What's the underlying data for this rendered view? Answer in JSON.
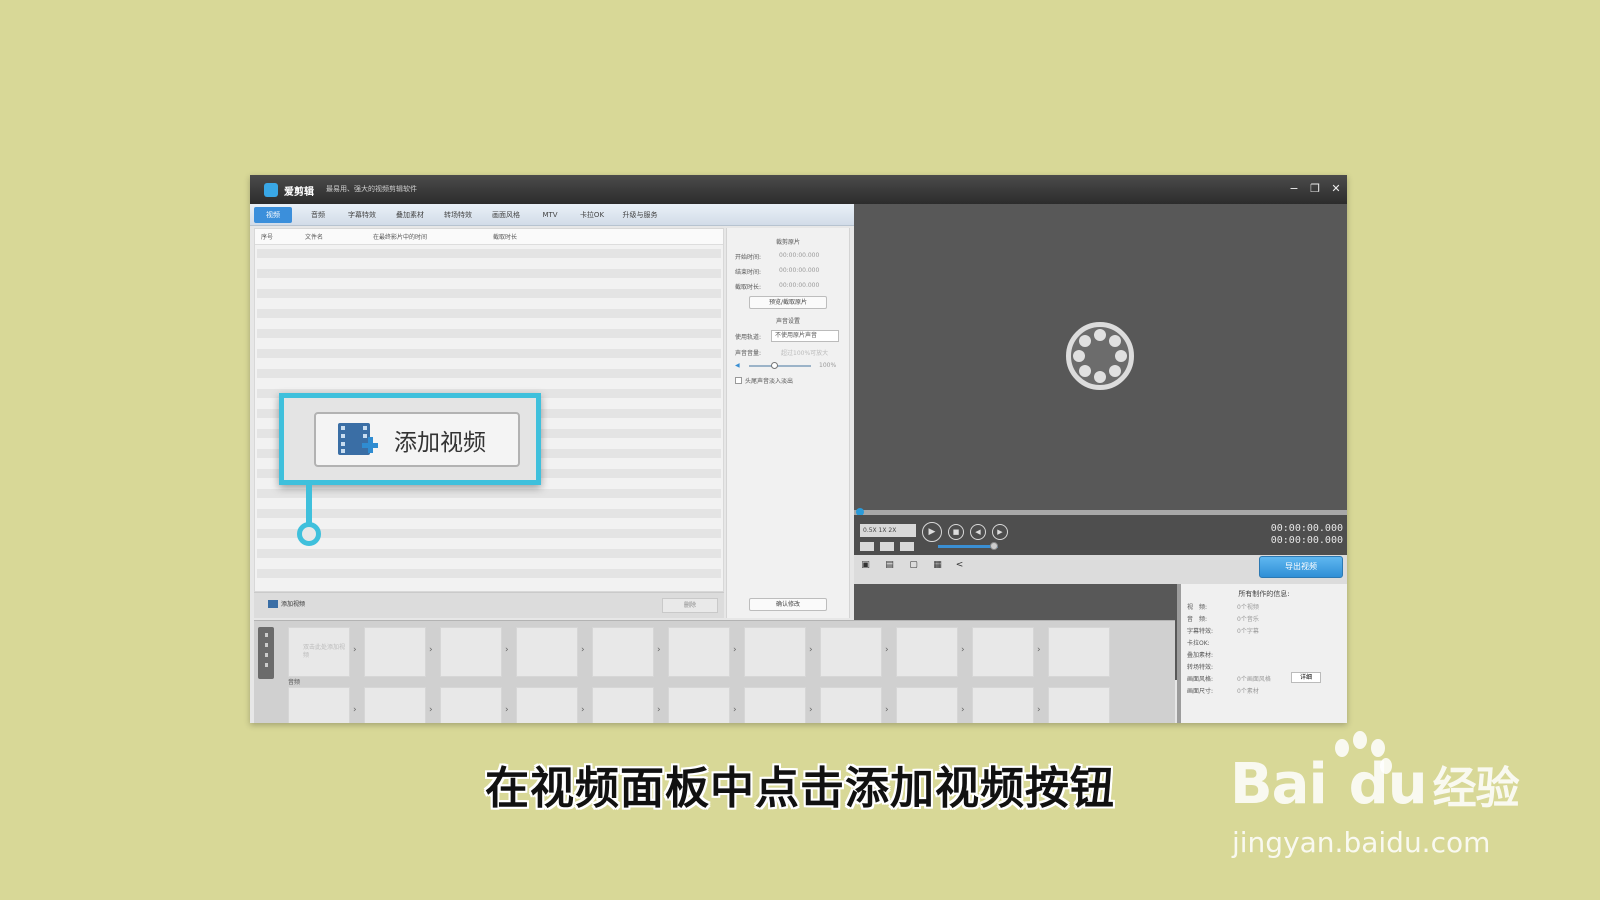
{
  "app": {
    "title": "爱剪辑",
    "subtitle": "最易用、强大的视频剪辑软件",
    "window_buttons": [
      "−",
      "❐",
      "✕"
    ]
  },
  "tabs": [
    {
      "label": "视频",
      "active": true
    },
    {
      "label": "音频",
      "active": false
    },
    {
      "label": "字幕特效",
      "active": false
    },
    {
      "label": "叠加素材",
      "active": false
    },
    {
      "label": "转场特效",
      "active": false
    },
    {
      "label": "画面风格",
      "active": false
    },
    {
      "label": "MTV",
      "active": false
    },
    {
      "label": "卡拉OK",
      "active": false
    },
    {
      "label": "升级与服务",
      "active": false
    }
  ],
  "list": {
    "columns": [
      "序号",
      "文件名",
      "在最终影片中的时间",
      "截取时长"
    ],
    "add_label": "添加视频",
    "delete_label": "删除"
  },
  "settings": {
    "clip_title": "裁剪原片",
    "start_label": "开始时间:",
    "start_value": "00:00:00.000",
    "end_label": "结束时间:",
    "end_value": "00:00:00.000",
    "duration_label": "截取时长:",
    "duration_value": "00:00:00.000",
    "preview_btn": "预览/截取原片",
    "audio_title": "声音设置",
    "track_label": "使用轨道:",
    "track_value": "不使用原片声音",
    "delay_label": "声音音量:",
    "delay_value": "超过100%可放大",
    "volume_value": "100%",
    "checkbox_label": "头尾声音淡入淡出",
    "confirm_btn": "确认修改"
  },
  "player": {
    "speed_label": "0.5X  1X  2X",
    "timecode_current": "00:00:00.000",
    "timecode_total": "00:00:00.000",
    "export_label": "导出视频"
  },
  "timeline": {
    "placeholder_text": "双击此处添加视频",
    "row_label": "音频"
  },
  "info": {
    "title": "所有制作的信息:",
    "rows": [
      {
        "label": "视　频:",
        "value": "0个视频"
      },
      {
        "label": "音　频:",
        "value": "0个音乐"
      },
      {
        "label": "字幕特效:",
        "value": "0个字幕"
      },
      {
        "label": "卡拉OK:",
        "value": ""
      },
      {
        "label": "叠加素材:",
        "value": ""
      },
      {
        "label": "转场特效:",
        "value": ""
      },
      {
        "label": "画面风格:",
        "value": "0个画面风格"
      },
      {
        "label": "画面尺寸:",
        "value": "0个素材"
      }
    ],
    "mini_btn": "详细"
  },
  "callout": {
    "label": "添加视频"
  },
  "caption": "在视频面板中点击添加视频按钮",
  "watermark": {
    "logo_left": "Bai",
    "logo_mid": "du",
    "logo_right": "经验",
    "url": "jingyan.baidu.com"
  },
  "colors": {
    "background": "#d8d897",
    "accent": "#3fc0dc",
    "tab_active": "#3b8fdb"
  }
}
